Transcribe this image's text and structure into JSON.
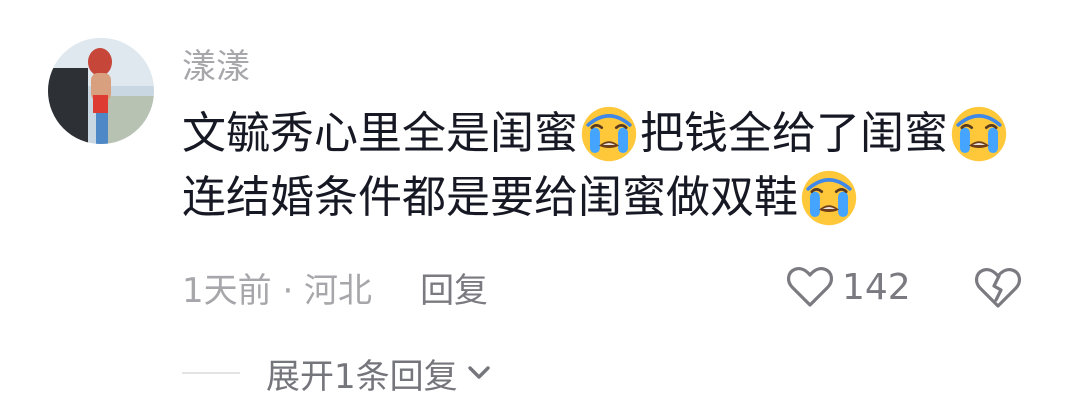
{
  "comment": {
    "username": "漾漾",
    "lines": [
      {
        "parts": [
          "文毓秀心里全是闺蜜",
          "把钱全给了闺蜜"
        ]
      },
      {
        "parts": [
          "连结婚条件都是要给闺蜜做双鞋"
        ]
      }
    ],
    "emoji": "loudly-crying-face",
    "meta": "1天前 · 河北",
    "reply_label": "回复",
    "like_count": "142",
    "expand_label": "展开1条回复"
  },
  "colors": {
    "text": "#161823",
    "secondary": "#a6a6ab",
    "emoji_face": "#ffc83a",
    "emoji_tear": "#40a9ff"
  }
}
